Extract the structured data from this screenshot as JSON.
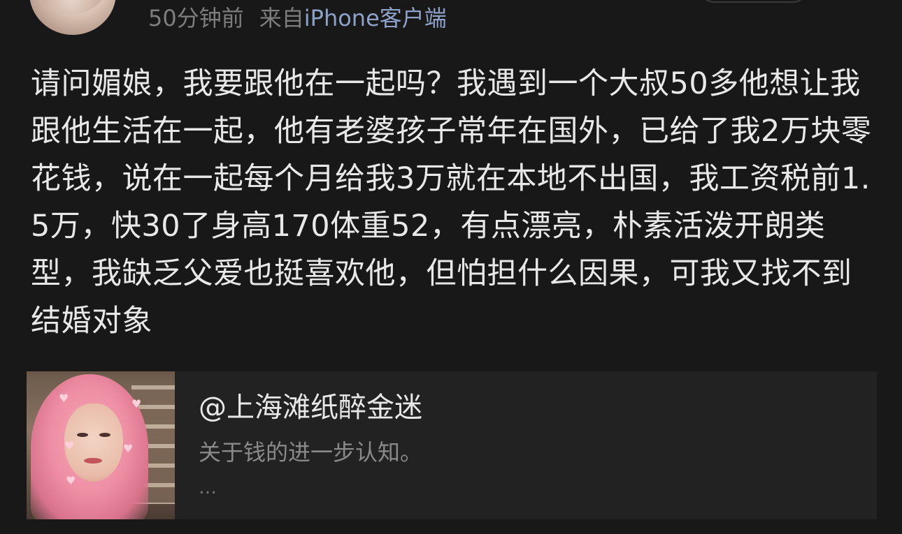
{
  "post": {
    "meta": {
      "time": "50分钟前",
      "source_prefix": "来自",
      "source_name": "iPhone客户端"
    },
    "text": "请问媚娘，我要跟他在一起吗？我遇到一个大叔50多他想让我跟他生活在一起，他有老婆孩子常年在国外，已给了我2万块零花钱，说在一起每个月给我3万就在本地不出国，我工资税前1.5万，快30了身高170体重52，有点漂亮，朴素活泼开朗类型，我缺乏父爱也挺喜欢他，但怕担什么因果，可我又找不到结婚对象"
  },
  "linked_card": {
    "title": "@上海滩纸醉金迷",
    "description": "关于钱的进一步认知。",
    "more": "…"
  },
  "colors": {
    "background": "#181818",
    "text_primary": "#e8e8e8",
    "text_secondary": "#7d7d7d",
    "source_link": "#8ea2c9",
    "card_background": "#222222"
  }
}
